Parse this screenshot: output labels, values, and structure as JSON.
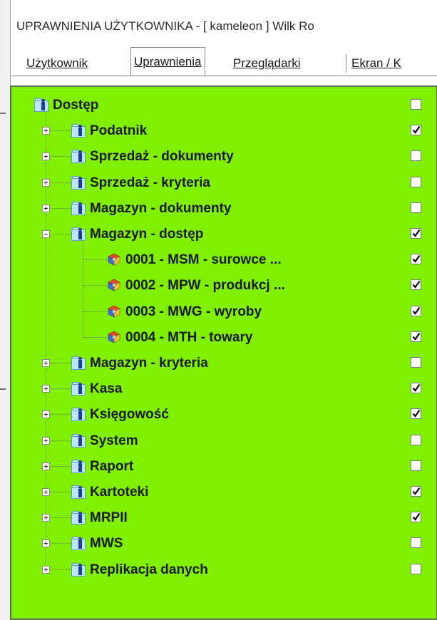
{
  "window": {
    "title": "UPRAWNIENIA UŻYTKOWNIKA - [ kameleon ] Wilk Ro"
  },
  "tabs": [
    {
      "label": "Użytkownik",
      "active": false
    },
    {
      "label": "Uprawnienia",
      "active": true
    },
    {
      "label": "Przeglądarki",
      "active": false
    },
    {
      "label": "Ekran / K",
      "active": false
    }
  ],
  "tree": {
    "background_color": "#80f000",
    "root": {
      "label": "Dostęp",
      "checked": false,
      "icon": "folder-user-icon"
    },
    "nodes": [
      {
        "label": "Podatnik",
        "checked": true,
        "expanded": false,
        "icon": "folder-user-icon",
        "children": []
      },
      {
        "label": "Sprzedaż - dokumenty",
        "checked": false,
        "expanded": false,
        "icon": "folder-user-icon",
        "children": []
      },
      {
        "label": "Sprzedaż - kryteria",
        "checked": false,
        "expanded": false,
        "icon": "folder-user-icon",
        "children": []
      },
      {
        "label": "Magazyn - dokumenty",
        "checked": false,
        "expanded": false,
        "icon": "folder-user-icon",
        "children": []
      },
      {
        "label": "Magazyn - dostęp",
        "checked": true,
        "expanded": true,
        "icon": "folder-user-icon",
        "children": [
          {
            "label": "0001 - MSM - surowce  ...",
            "checked": true,
            "icon": "warehouse-cube-icon"
          },
          {
            "label": "0002 - MPW - produkcj ...",
            "checked": true,
            "icon": "warehouse-cube-icon"
          },
          {
            "label": "0003 - MWG - wyroby",
            "checked": true,
            "icon": "warehouse-cube-icon"
          },
          {
            "label": "0004 - MTH - towary",
            "checked": true,
            "icon": "warehouse-cube-icon"
          }
        ]
      },
      {
        "label": "Magazyn - kryteria",
        "checked": false,
        "expanded": false,
        "icon": "folder-user-icon",
        "children": []
      },
      {
        "label": "Kasa",
        "checked": true,
        "expanded": false,
        "icon": "folder-user-icon",
        "children": []
      },
      {
        "label": "Księgowość",
        "checked": true,
        "expanded": false,
        "icon": "folder-user-icon",
        "children": []
      },
      {
        "label": "System",
        "checked": false,
        "expanded": false,
        "icon": "folder-user-icon",
        "children": []
      },
      {
        "label": "Raport",
        "checked": false,
        "expanded": false,
        "icon": "folder-user-icon",
        "children": []
      },
      {
        "label": "Kartoteki",
        "checked": true,
        "expanded": false,
        "icon": "folder-user-icon",
        "children": []
      },
      {
        "label": "MRPII",
        "checked": true,
        "expanded": false,
        "icon": "folder-user-icon",
        "children": []
      },
      {
        "label": "MWS",
        "checked": false,
        "expanded": false,
        "icon": "folder-user-icon",
        "children": []
      },
      {
        "label": "Replikacja danych",
        "checked": false,
        "expanded": false,
        "icon": "folder-user-icon",
        "children": []
      }
    ]
  }
}
